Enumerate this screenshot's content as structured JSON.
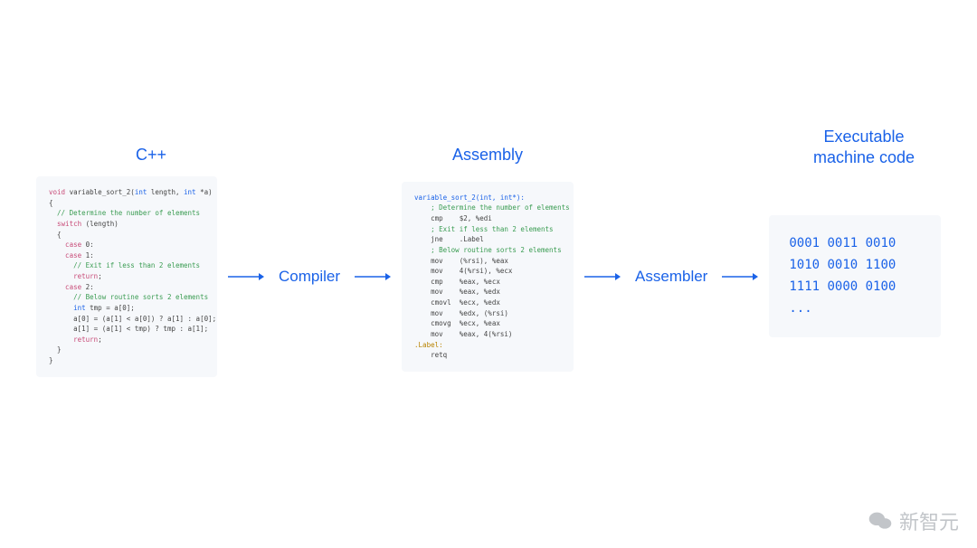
{
  "headings": {
    "cpp": "C++",
    "assembly": "Assembly",
    "machine": "Executable\nmachine code"
  },
  "labels": {
    "compiler": "Compiler",
    "assembler": "Assembler"
  },
  "cpp_code": {
    "l1_a": "void",
    "l1_b": " variable_sort_2(",
    "l1_c": "int",
    "l1_d": " length, ",
    "l1_e": "int",
    "l1_f": " *a)",
    "l2": "{",
    "l3_a": "  // Determine the number of elements",
    "l4_a": "  switch",
    "l4_b": " (length)",
    "l5": "  {",
    "l6_a": "    case",
    "l6_b": " 0:",
    "l7_a": "    case",
    "l7_b": " 1:",
    "l8": "      // Exit if less than 2 elements",
    "l9_a": "      return",
    "l9_b": ";",
    "l10_a": "    case",
    "l10_b": " 2:",
    "l11": "      // Below routine sorts 2 elements",
    "l12_a": "      int",
    "l12_b": " tmp = a[0];",
    "l13": "      a[0] = (a[1] < a[0]) ? a[1] : a[0];",
    "l14": "      a[1] = (a[1] < tmp) ? tmp : a[1];",
    "l15_a": "      return",
    "l15_b": ";",
    "l16": "  }",
    "l17": "}"
  },
  "asm_code": {
    "l1": "variable_sort_2(int, int*):",
    "l2": "    ; Determine the number of elements",
    "l3": "    cmp    $2, %edi",
    "l4": "    ; Exit if less than 2 elements",
    "l5": "    jne    .Label",
    "l6": "    ; Below routine sorts 2 elements",
    "l7": "    mov    (%rsi), %eax",
    "l8": "    mov    4(%rsi), %ecx",
    "l9": "    cmp    %eax, %ecx",
    "l10": "    mov    %eax, %edx",
    "l11": "    cmovl  %ecx, %edx",
    "l12": "    mov    %edx, (%rsi)",
    "l13": "    cmovg  %ecx, %eax",
    "l14": "    mov    %eax, 4(%rsi)",
    "l15": ".Label:",
    "l16": "    retq"
  },
  "machine_code": "0001 0011 0010\n1010 0010 1100\n1111 0000 0100\n...",
  "watermark": "新智元"
}
